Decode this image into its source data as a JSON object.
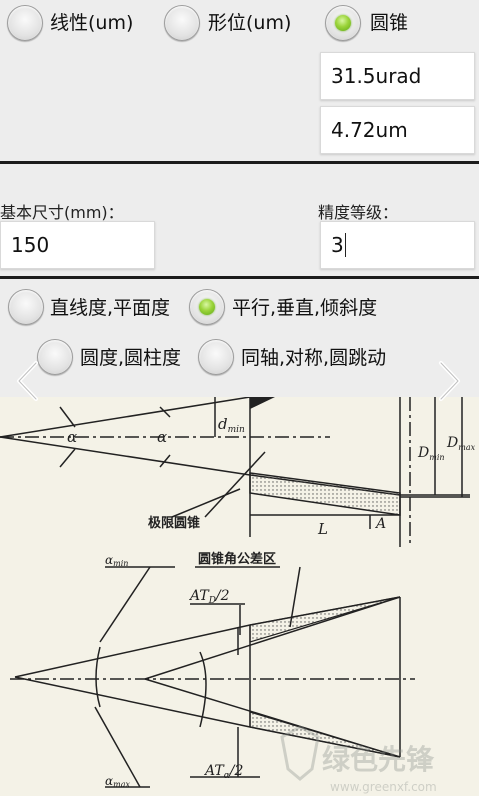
{
  "mode_options": [
    {
      "label": "线性(um)",
      "selected": false
    },
    {
      "label": "形位(um)",
      "selected": false
    },
    {
      "label": "圆锥",
      "selected": true
    }
  ],
  "results": {
    "angle_value": "31.5urad",
    "length_value": "4.72um"
  },
  "form": {
    "basic_size_label": "基本尺寸(mm)：",
    "basic_size_value": "150",
    "grade_label": "精度等级：",
    "grade_value": "3"
  },
  "tolerance_types": [
    {
      "label": "直线度,平面度",
      "selected": false
    },
    {
      "label": "平行,垂直,倾斜度",
      "selected": true
    },
    {
      "label": "圆度,圆柱度",
      "selected": false
    },
    {
      "label": "同轴,对称,圆跳动",
      "selected": false
    }
  ],
  "diagram": {
    "alpha": "α",
    "d_min": "d",
    "d_min_sub": "min",
    "D_min": "D",
    "D_min_sub": "min",
    "D_max": "D",
    "D_max_sub": "max",
    "limit_cone_label": "极限圆锥",
    "L": "L",
    "A": "A",
    "alpha_min": "α",
    "alpha_min_sub": "min",
    "alpha_max": "α",
    "alpha_max_sub": "max",
    "cone_angle_zone_label": "圆锥角公差区",
    "atd_label": "AT",
    "atd_sub": "D",
    "atd_div": "/2",
    "ata_label": "AT",
    "ata_sub": "α",
    "ata_div": "/2"
  },
  "watermark": {
    "brand": "绿色先锋",
    "url": "www.greenxf.com"
  },
  "colors": {
    "accent_green": "#8fd12e",
    "background": "#ededed",
    "divider": "#1c1c1c"
  },
  "icons": {
    "prev": "chevron-left-icon",
    "next": "chevron-right-icon"
  }
}
